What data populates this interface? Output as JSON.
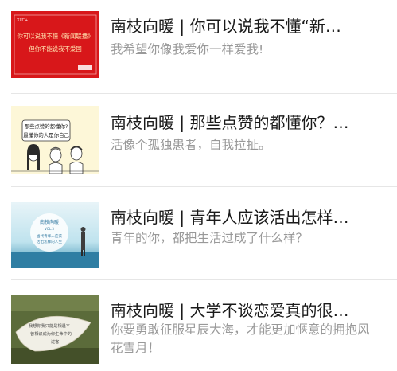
{
  "articles": [
    {
      "title": "南枝向暖 | 你可以说我不懂“新…",
      "digest": "我希望你像我爱你一样爱我!",
      "thumb": {
        "icon": "red-card-image",
        "bg": "#d8171a",
        "badge": "XXC+",
        "lines": [
          "你可以说我不懂《新闻联播》",
          "但你不能说我不爱国"
        ]
      }
    },
    {
      "title": "南枝向暖 | 那些点赞的都懂你？…",
      "digest": "活像个孤独患者，自我拉扯。",
      "thumb": {
        "icon": "cartoon-people-image",
        "bg": "#fdf7d8",
        "lines": [
          "那些点赞的都懂你?",
          "最懂你的人是你自己"
        ]
      }
    },
    {
      "title": "南枝向暖 | 青年人应该活出怎样…",
      "digest": "青年的你，都把生活过成了什么样？",
      "thumb": {
        "icon": "sea-horizon-image",
        "bg": "#bfe3ee",
        "lines": [
          "南枝向暖",
          "VOL.3",
          "当代青年人应该",
          "活出怎样的人生"
        ]
      }
    },
    {
      "title": "南枝向暖 | 大学不谈恋爱真的很…",
      "digest": "你要勇敢征服星辰大海，才能更加惬意的拥抱风花雪月！",
      "thumb": {
        "icon": "leaf-handwriting-image",
        "bg": "#5b6b3a",
        "lines": [
          "我想你我只能是相遇不",
          "曾相识成为你生命中的",
          "过客"
        ]
      }
    }
  ]
}
